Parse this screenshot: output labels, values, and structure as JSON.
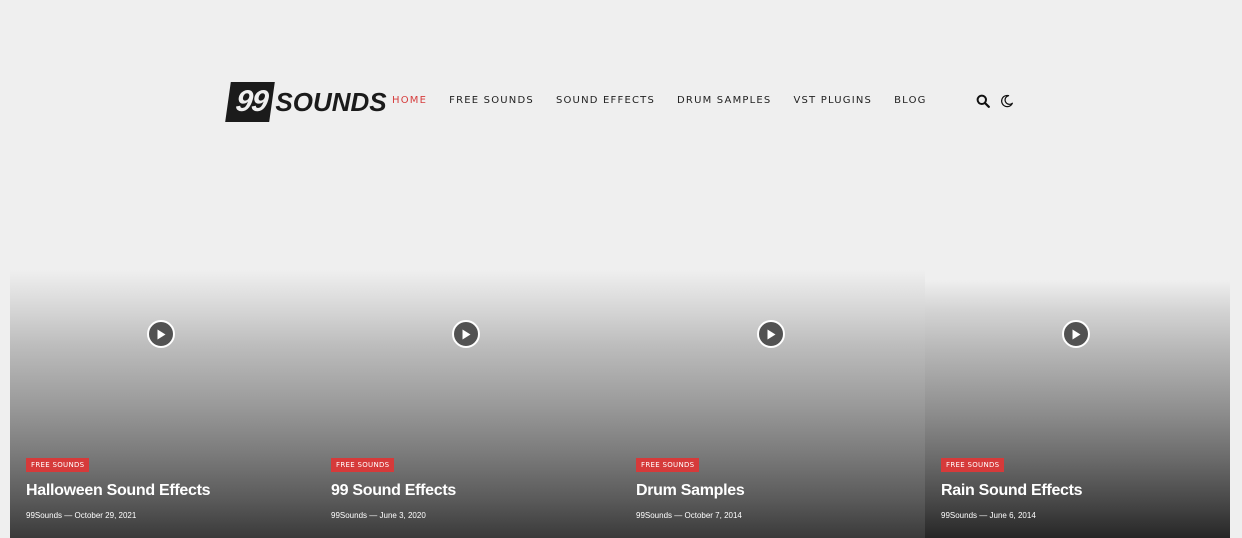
{
  "header": {
    "logo": {
      "badge": "99",
      "word": "SOUNDS"
    },
    "nav": [
      {
        "label": "HOME",
        "active": true
      },
      {
        "label": "FREE SOUNDS"
      },
      {
        "label": "SOUND EFFECTS"
      },
      {
        "label": "DRUM SAMPLES"
      },
      {
        "label": "VST PLUGINS"
      },
      {
        "label": "BLOG"
      }
    ],
    "icons": [
      "search-icon",
      "dark-mode-moon-icon"
    ]
  },
  "cards": [
    {
      "category": "FREE SOUNDS",
      "title": "Halloween Sound Effects",
      "author": "99Sounds",
      "separator": "—",
      "date": "October 29, 2021"
    },
    {
      "category": "FREE SOUNDS",
      "title": "99 Sound Effects",
      "author": "99Sounds",
      "separator": "—",
      "date": "June 3, 2020"
    },
    {
      "category": "FREE SOUNDS",
      "title": "Drum Samples",
      "author": "99Sounds",
      "separator": "—",
      "date": "October 7, 2014"
    },
    {
      "category": "FREE SOUNDS",
      "title": "Rain Sound Effects",
      "author": "99Sounds",
      "separator": "—",
      "date": "June 6, 2014"
    }
  ],
  "colors": {
    "accent": "#d63d3d",
    "text_dark": "#1b1b1b",
    "background": "#efefef"
  }
}
